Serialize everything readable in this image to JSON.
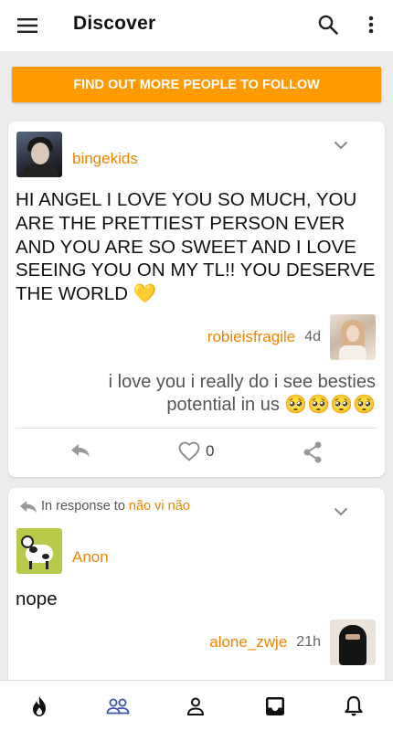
{
  "app_bar": {
    "title": "Discover",
    "icons": [
      "menu-icon",
      "search-icon",
      "more-vert-icon"
    ]
  },
  "follow_banner": {
    "label": "FIND OUT MORE PEOPLE TO FOLLOW"
  },
  "posts": [
    {
      "author": "bingekids",
      "text": "HI ANGEL I LOVE YOU SO MUCH, YOU ARE THE PRETTIEST PERSON EVER AND YOU ARE SO SWEET AND I LOVE SEEING YOU ON MY TL!! YOU DESERVE THE WORLD 💛",
      "reply_user": "robieisfragile",
      "reply_time": "4d",
      "reply_text": "i love you i really do i see besties potential in us 🥺🥺🥺🥺",
      "like_count": "0"
    },
    {
      "in_response_label": "In response to",
      "in_response_user": "não vi não",
      "author": "Anon",
      "text": "nope",
      "reply_user": "alone_zwje",
      "reply_time": "21h"
    }
  ],
  "bottom_nav": {
    "items": [
      "flame-icon",
      "people-icon",
      "person-icon",
      "inbox-icon",
      "bell-icon"
    ],
    "active": "people-icon",
    "active_color": "#3f51b5"
  },
  "colors": {
    "accent": "#ff9a00",
    "username": "#f08400"
  }
}
